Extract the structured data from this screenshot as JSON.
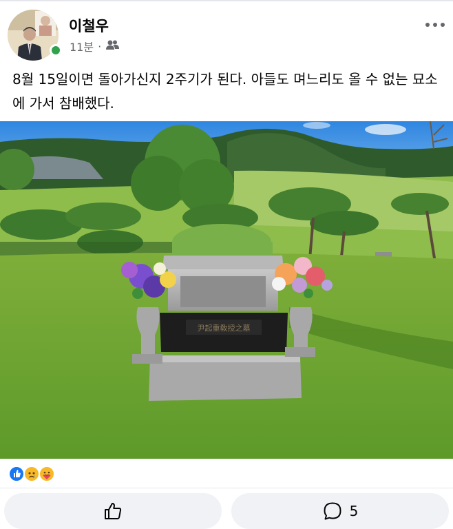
{
  "post": {
    "author_name": "이철우",
    "time": "11분",
    "separator": "·",
    "audience_icon": "friends-icon",
    "more_icon": "more-horizontal-icon",
    "text": "8월 15일이면 돌아가신지 2주기가 된다. 아들도 며느리도 올 수 없는 묘소에 가서 참배했다.",
    "photo": {
      "tombstone_inscription": "尹起重敎授之墓"
    }
  },
  "reactions": {
    "icons": [
      "like-reaction-icon",
      "sad-reaction-icon",
      "care-reaction-icon"
    ]
  },
  "actions": {
    "like_icon": "thumbs-up-icon",
    "comment_icon": "comment-icon",
    "comment_count": "5"
  },
  "colors": {
    "online": "#31a24c",
    "meta_gray": "#65676b",
    "action_bg": "#f0f2f5",
    "like_blue": "#1877f2"
  }
}
